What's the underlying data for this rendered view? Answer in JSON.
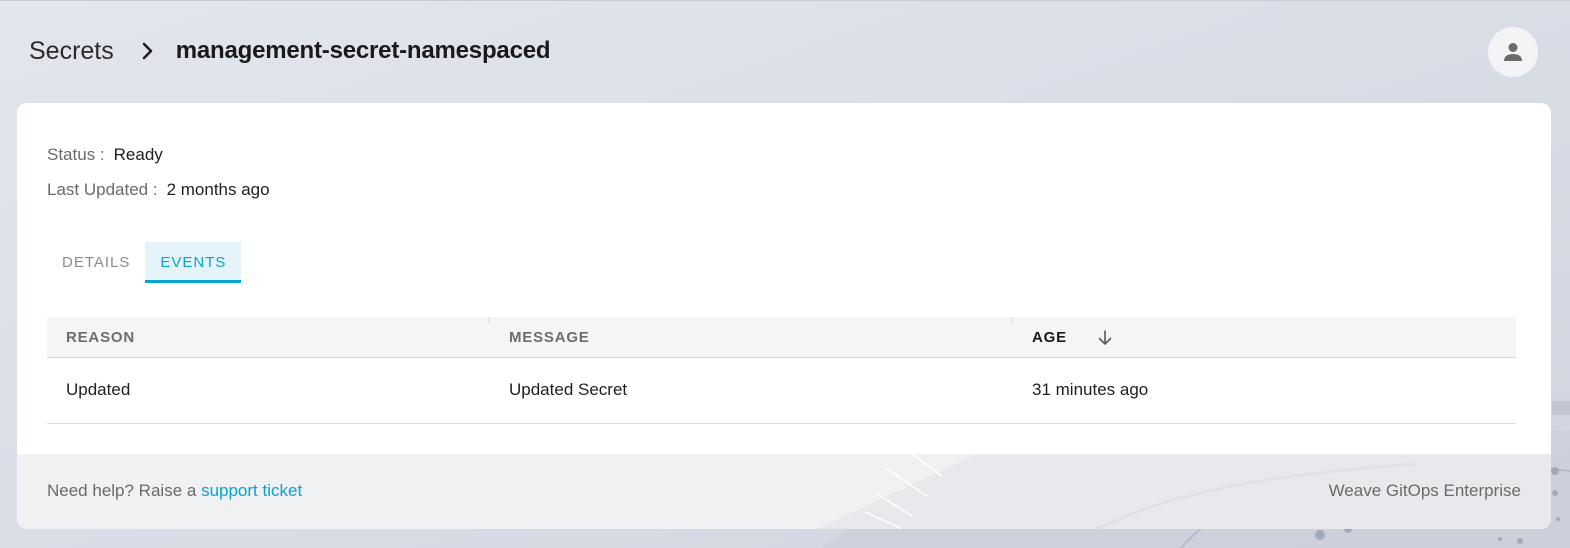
{
  "breadcrumb": {
    "parent": "Secrets",
    "current": "management-secret-namespaced"
  },
  "meta": {
    "status_label": "Status :",
    "status_value": "Ready",
    "updated_label": "Last Updated :",
    "updated_value": "2 months ago"
  },
  "tabs": [
    {
      "label": "DETAILS",
      "active": false
    },
    {
      "label": "EVENTS",
      "active": true
    }
  ],
  "table": {
    "columns": [
      "REASON",
      "MESSAGE",
      "AGE"
    ],
    "sorted_column": "AGE",
    "sort_direction": "descending",
    "rows": [
      {
        "reason": "Updated",
        "message": "Updated Secret",
        "age": "31 minutes ago"
      }
    ]
  },
  "footer": {
    "help_prefix": "Need help? Raise a",
    "help_link": "support ticket",
    "brand": "Weave GitOps Enterprise"
  },
  "colors": {
    "accent": "#06a3d6",
    "background": "#dde1ea",
    "card": "#ffffff"
  },
  "icons": {
    "breadcrumb_separator": "chevron-right-icon",
    "user": "person-icon",
    "sort": "arrow-down-icon"
  }
}
